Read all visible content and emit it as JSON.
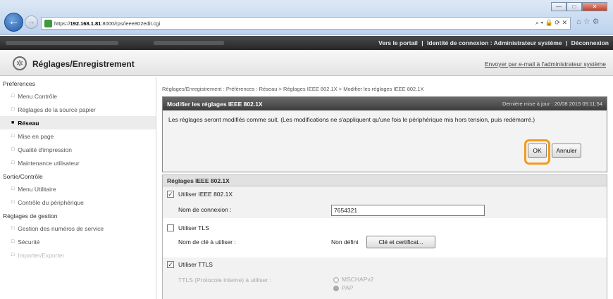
{
  "browser": {
    "url_prefix": "https://",
    "url_host": "192.168.1.81",
    "url_rest": ":8000/rps/ieee802edit.cgi",
    "addr_icons": "⌕ ▾ 🔒 ⟳ ✕",
    "toolbar_icons": "⌂ ☆ ⚙",
    "win_min": "—",
    "win_max": "□",
    "win_close": "✕",
    "back_glyph": "←",
    "forward_glyph": "→"
  },
  "topbar": {
    "portal": "Vers le portail",
    "identity": "Identité de connexion : Administrateur système",
    "logout": "Déconnexion",
    "sep": "|"
  },
  "header": {
    "title": "Réglages/Enregistrement",
    "mail_link": "Envoyer par e-mail à l'administrateur système",
    "gear_glyph": "✲"
  },
  "sidebar": {
    "group1": "Préférences",
    "items1": [
      {
        "label": "Menu Contrôle"
      },
      {
        "label": "Réglages de la source papier"
      },
      {
        "label": "Réseau"
      },
      {
        "label": "Mise en page"
      },
      {
        "label": "Qualité d'impression"
      },
      {
        "label": "Maintenance utilisateur"
      }
    ],
    "group2": "Sortie/Contrôle",
    "items2": [
      {
        "label": "Menu Utilitaire"
      },
      {
        "label": "Contrôle du périphérique"
      }
    ],
    "group3": "Réglages de gestion",
    "items3": [
      {
        "label": "Gestion des numéros de service"
      },
      {
        "label": "Sécurité"
      },
      {
        "label": "Importer/Exporter"
      }
    ]
  },
  "breadcrumb": "Réglages/Enregistrement : Préférences : Réseau > Réglages IEEE 802.1X > Modifier les réglages IEEE 802.1X",
  "panel": {
    "title": "Modifier les réglages IEEE 802.1X",
    "updated": "Dernière mise à jour : 20/08 2015 05:11:54",
    "message": "Les réglages seront modifiés comme suit. (Les modifications ne s'appliquent qu'une fois le périphérique mis hors tension, puis redémarré.)",
    "ok_label": "OK",
    "cancel_label": "Annuler"
  },
  "settings": {
    "section_title": "Réglages IEEE 802.1X",
    "use_ieee": {
      "label": "Utiliser IEEE 802.1X",
      "checked": "✓"
    },
    "login_name": {
      "label": "Nom de connexion :",
      "value": "7654321"
    },
    "use_tls": {
      "label": "Utiliser TLS",
      "checked": ""
    },
    "key_name": {
      "label": "Nom de clé à utiliser :",
      "value": "Non défini",
      "button": "Clé et certificat..."
    },
    "use_ttls": {
      "label": "Utiliser TTLS",
      "checked": "✓"
    },
    "ttls_protocol": {
      "label": "TTLS (Protocole interne) à utiliser :",
      "options": [
        "MSCHAPv2",
        "PAP"
      ]
    }
  }
}
